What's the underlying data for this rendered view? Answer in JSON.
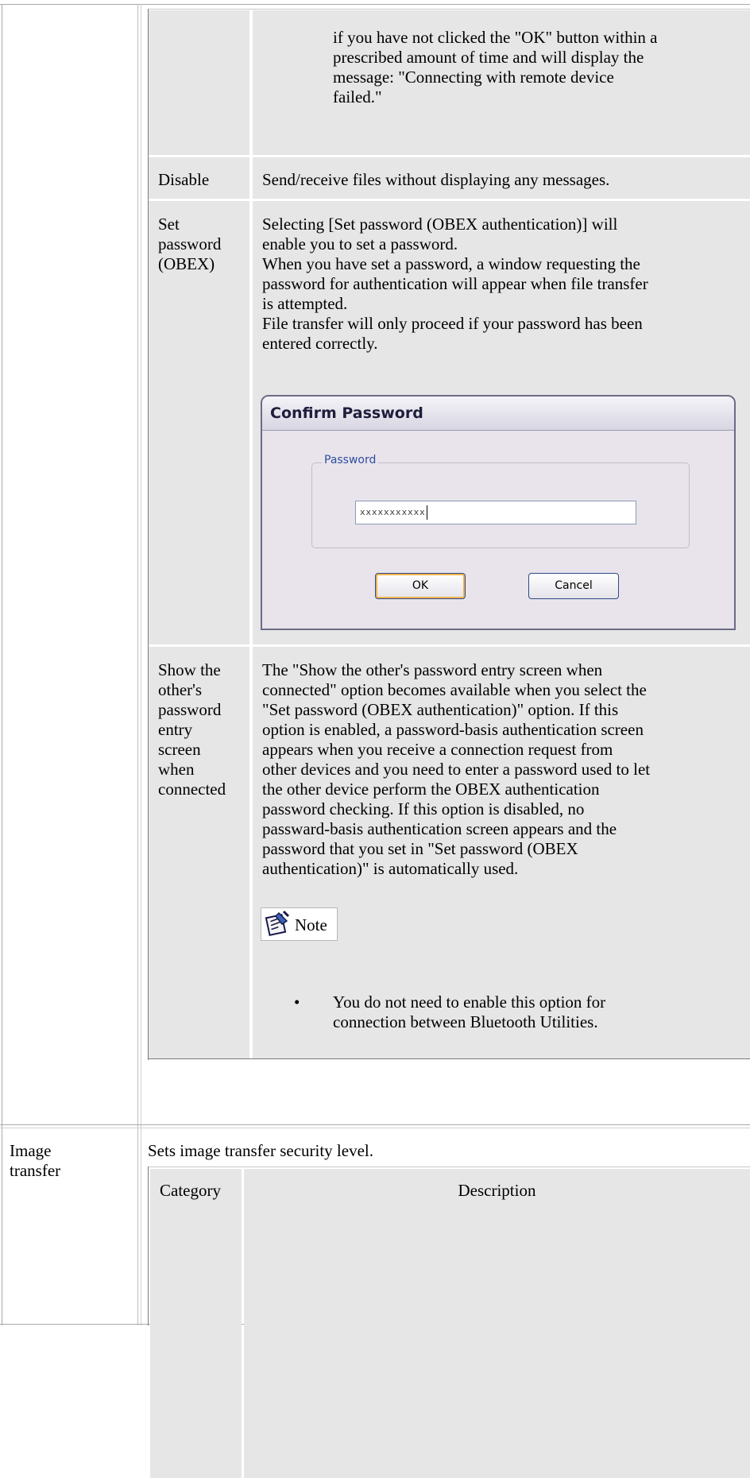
{
  "upper_table": {
    "top_description_lines": [
      "if you have not clicked the \"OK\" button within a",
      "prescribed amount of time and will display the",
      "message: \"Connecting with remote device",
      "failed.\""
    ],
    "rows": [
      {
        "category_lines": [
          "Disable"
        ],
        "description_lines": [
          "Send/receive files without displaying any messages."
        ]
      },
      {
        "category_lines": [
          "Set",
          "password",
          "(OBEX)"
        ],
        "description_lines": [
          "Selecting [Set password (OBEX authentication)] will",
          "enable you to set a password.",
          "When you have set a password, a window requesting the",
          "password for authentication will appear when file transfer",
          "is attempted.",
          "File transfer will only proceed if your password has been",
          "entered correctly."
        ]
      },
      {
        "category_lines": [
          "Show the",
          "other's",
          "password",
          "entry",
          "screen",
          "when",
          "connected"
        ],
        "description_lines": [
          "The \"Show the other's password entry screen when",
          "connected\" option becomes available when you select the",
          "\"Set password (OBEX authentication)\" option. If this",
          "option is enabled, a password-basis authentication screen",
          "appears when you receive a connection request from",
          "other devices and you need to enter a password used to let",
          "the other device perform the OBEX authentication",
          "password checking. If this option is disabled, no",
          "passward-basis authentication screen appears and the",
          "password that you set in \"Set password (OBEX",
          "authentication)\" is automatically used."
        ],
        "note_label": "Note",
        "note_bullet_lines": [
          "You do not need to enable this option for",
          "connection between Bluetooth Utilities."
        ]
      }
    ]
  },
  "dialog": {
    "title": "Confirm Password",
    "group_label": "Password",
    "password_value": "xxxxxxxxxxx",
    "ok_label": "OK",
    "cancel_label": "Cancel"
  },
  "image_transfer": {
    "label_lines": [
      "Image",
      "transfer"
    ],
    "intro": "Sets image transfer security level.",
    "header_category": "Category",
    "header_description": "Description"
  }
}
